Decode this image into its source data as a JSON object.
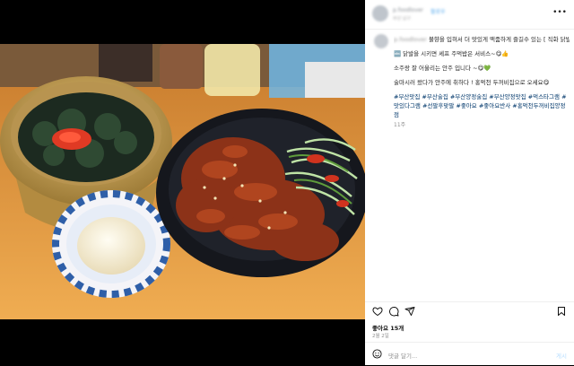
{
  "header": {
    "username": "p.foodlover",
    "follow_label": "팔로우",
    "location": "부산 남구",
    "more_icon": "more-horizontal-icon"
  },
  "caption": {
    "username": "p.foodlover",
    "lines": [
      "불향을 입혀서 더 맛있게 맥줌하게 즐길수 있는 [ 직화 닭발🐔]",
      "",
      "🔤 닭발을 시키면 셰프 주먹밥은 서비스~😋👍",
      "",
      "소주랑 잘 어울리는 안주 입니다 ~😋💚",
      "",
      "술마시러 왔다가 안주에 취하다 ! 홍먹천 두꺼비집으로 오세요😋"
    ],
    "hashtags": "#부산맛집 #부산술집 #부산양정술집 #부산양정맛집 #먹스타그램 #맛있다그램 #선팔후맞팔 #좋아요 #좋아요반사 #홍먹천두꺼비집양정점",
    "time": "11주"
  },
  "actions": {
    "like_icon": "heart-icon",
    "comment_icon": "comment-icon",
    "share_icon": "share-icon",
    "save_icon": "bookmark-icon"
  },
  "likes": "좋아요 15개",
  "date": "2월 2일",
  "comment": {
    "emoji_icon": "emoji-icon",
    "placeholder": "댓글 달기...",
    "post_label": "게시"
  },
  "photo": {
    "alt_subject": "spicy chicken feet with rice bowl and mayo",
    "colors": {
      "table": "#e9a24a",
      "bowl": "#d7b26a",
      "plate": "#14161c",
      "sauce": "#9a3a1e"
    }
  }
}
